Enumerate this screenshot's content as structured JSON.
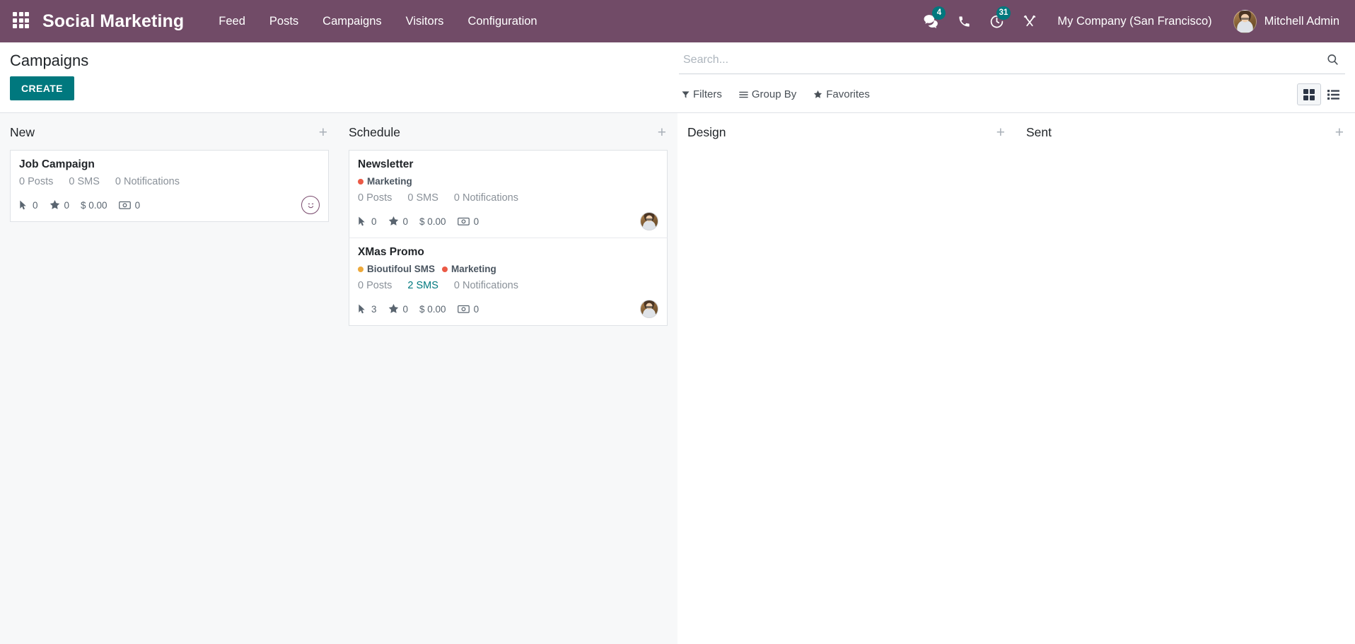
{
  "navbar": {
    "apps_icon": "apps-grid-icon",
    "brand": "Social Marketing",
    "menu": [
      {
        "label": "Feed"
      },
      {
        "label": "Posts"
      },
      {
        "label": "Campaigns"
      },
      {
        "label": "Visitors"
      },
      {
        "label": "Configuration"
      }
    ],
    "icons": [
      {
        "name": "messages-icon",
        "badge": "4"
      },
      {
        "name": "phone-icon",
        "badge": ""
      },
      {
        "name": "activity-clock-icon",
        "badge": "31"
      },
      {
        "name": "tools-icon",
        "badge": ""
      }
    ],
    "company": "My Company (San Francisco)",
    "user": "Mitchell Admin",
    "badge_color": "#00787e",
    "bg_color": "#714B67"
  },
  "control_panel": {
    "title": "Campaigns",
    "create_label": "CREATE",
    "create_color": "#00787e",
    "search": {
      "placeholder": "Search...",
      "value": ""
    },
    "search_icon": "search-icon",
    "filters": [
      {
        "name": "filters",
        "label": "Filters",
        "icon": "funnel-icon"
      },
      {
        "name": "group-by",
        "label": "Group By",
        "icon": "bars-icon"
      },
      {
        "name": "favorites",
        "label": "Favorites",
        "icon": "star-icon"
      }
    ],
    "views": [
      {
        "name": "kanban-view",
        "icon": "grid-icon",
        "active": true
      },
      {
        "name": "list-view",
        "icon": "list-icon",
        "active": false
      }
    ]
  },
  "kanban": {
    "add_label": "+",
    "columns": [
      {
        "title": "New",
        "cards": [
          {
            "title": "Job Campaign",
            "tags": [],
            "counts": [
              {
                "label": "0 Posts",
                "link": false
              },
              {
                "label": "0 SMS",
                "link": false
              },
              {
                "label": "0 Notifications",
                "link": false
              }
            ],
            "stats": {
              "clicks": "0",
              "leads": "0",
              "revenue": "$ 0.00",
              "quotations": "0"
            },
            "avatar": "smiley"
          }
        ]
      },
      {
        "title": "Schedule",
        "cards": [
          {
            "title": "Newsletter",
            "tags": [
              {
                "label": "Marketing",
                "color": "#eb5a46"
              }
            ],
            "counts": [
              {
                "label": "0 Posts",
                "link": false
              },
              {
                "label": "0 SMS",
                "link": false
              },
              {
                "label": "0 Notifications",
                "link": false
              }
            ],
            "stats": {
              "clicks": "0",
              "leads": "0",
              "revenue": "$ 0.00",
              "quotations": "0"
            },
            "avatar": "photo"
          },
          {
            "title": "XMas Promo",
            "tags": [
              {
                "label": "Bioutifoul SMS",
                "color": "#eda martins"
              },
              {
                "label": "Marketing",
                "color": "#eb5a46"
              }
            ],
            "counts": [
              {
                "label": "0 Posts",
                "link": false
              },
              {
                "label": "2 SMS",
                "link": true
              },
              {
                "label": "0 Notifications",
                "link": false
              }
            ],
            "stats": {
              "clicks": "3",
              "leads": "0",
              "revenue": "$ 0.00",
              "quotations": "0"
            },
            "avatar": "photo"
          }
        ]
      },
      {
        "title": "Design",
        "cards": []
      },
      {
        "title": "Sent",
        "cards": []
      }
    ]
  }
}
